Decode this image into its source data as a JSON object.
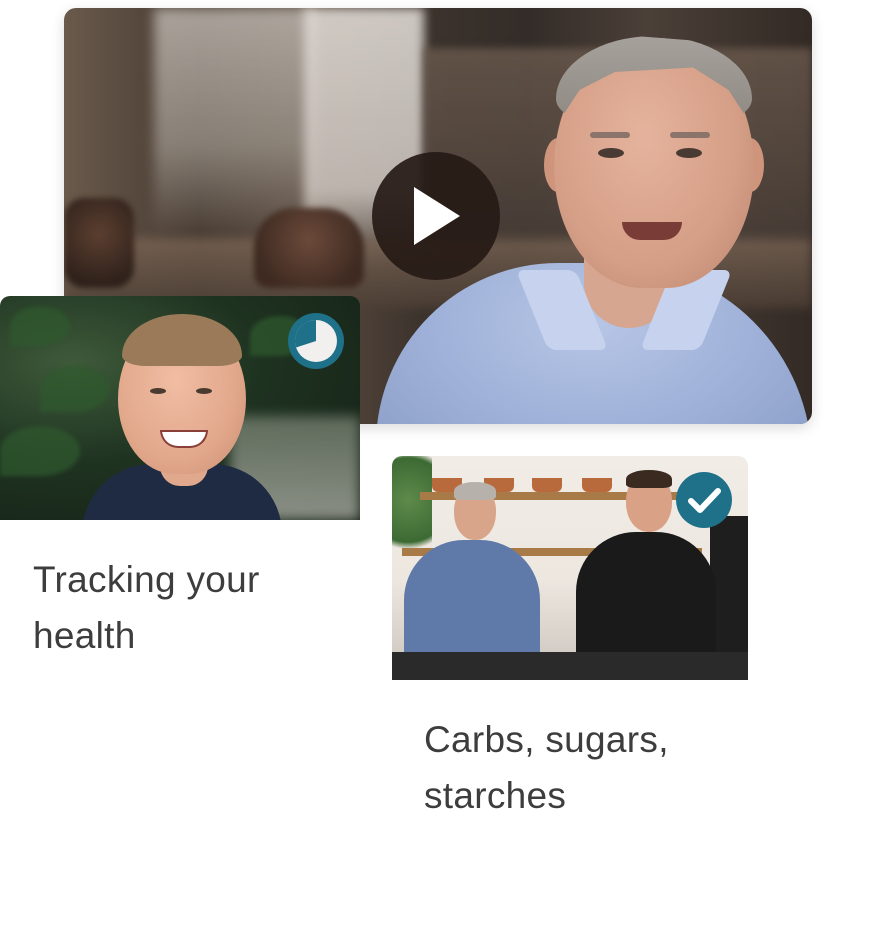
{
  "featured_video": {
    "play_icon": "play-icon"
  },
  "lessons": [
    {
      "title": "Tracking your health",
      "status": "in-progress",
      "progress_fraction": 0.7,
      "badge_icon": "progress-pie-icon"
    },
    {
      "title": "Carbs, sugars, starches",
      "status": "completed",
      "badge_icon": "checkmark-icon"
    }
  ],
  "colors": {
    "accent": "#1e7189",
    "badge_fill": "#f2f0ee",
    "text": "#3d3d3d",
    "play_bg": "#261a16"
  }
}
